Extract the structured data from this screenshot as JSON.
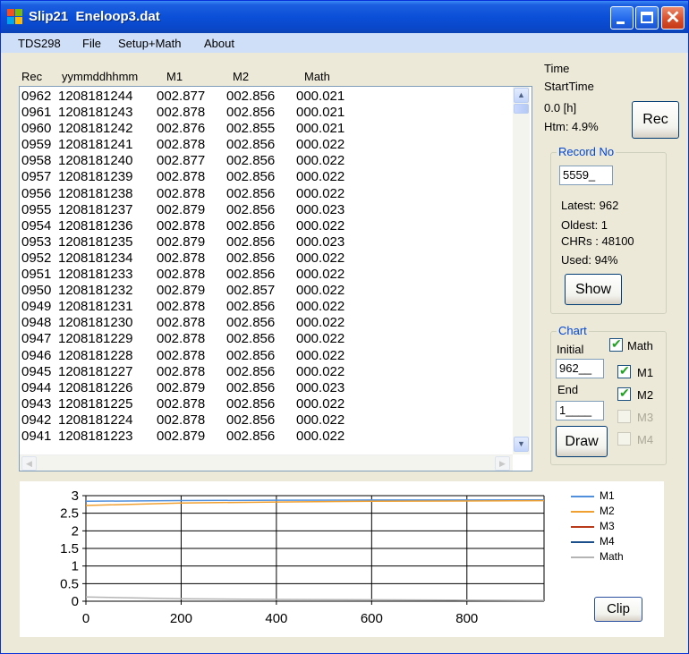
{
  "window": {
    "title": "Slip21  Eneloop3.dat",
    "controls": {
      "minimize": "minimize-icon",
      "maximize": "maximize-icon",
      "close": "close-icon"
    }
  },
  "menu": [
    "TDS298",
    "File",
    "Setup+Math",
    "About"
  ],
  "table": {
    "headers": [
      "Rec",
      "yymmddhhmm",
      "M1",
      "M2",
      "Math"
    ],
    "rows": [
      [
        "0962",
        "1208181244",
        "002.877",
        "002.856",
        "000.021"
      ],
      [
        "0961",
        "1208181243",
        "002.878",
        "002.856",
        "000.021"
      ],
      [
        "0960",
        "1208181242",
        "002.876",
        "002.855",
        "000.021"
      ],
      [
        "0959",
        "1208181241",
        "002.878",
        "002.856",
        "000.022"
      ],
      [
        "0958",
        "1208181240",
        "002.877",
        "002.856",
        "000.022"
      ],
      [
        "0957",
        "1208181239",
        "002.878",
        "002.856",
        "000.022"
      ],
      [
        "0956",
        "1208181238",
        "002.878",
        "002.856",
        "000.022"
      ],
      [
        "0955",
        "1208181237",
        "002.879",
        "002.856",
        "000.023"
      ],
      [
        "0954",
        "1208181236",
        "002.878",
        "002.856",
        "000.022"
      ],
      [
        "0953",
        "1208181235",
        "002.879",
        "002.856",
        "000.023"
      ],
      [
        "0952",
        "1208181234",
        "002.878",
        "002.856",
        "000.022"
      ],
      [
        "0951",
        "1208181233",
        "002.878",
        "002.856",
        "000.022"
      ],
      [
        "0950",
        "1208181232",
        "002.879",
        "002.857",
        "000.022"
      ],
      [
        "0949",
        "1208181231",
        "002.878",
        "002.856",
        "000.022"
      ],
      [
        "0948",
        "1208181230",
        "002.878",
        "002.856",
        "000.022"
      ],
      [
        "0947",
        "1208181229",
        "002.878",
        "002.856",
        "000.022"
      ],
      [
        "0946",
        "1208181228",
        "002.878",
        "002.856",
        "000.022"
      ],
      [
        "0945",
        "1208181227",
        "002.878",
        "002.856",
        "000.022"
      ],
      [
        "0944",
        "1208181226",
        "002.879",
        "002.856",
        "000.023"
      ],
      [
        "0943",
        "1208181225",
        "002.878",
        "002.856",
        "000.022"
      ],
      [
        "0942",
        "1208181224",
        "002.878",
        "002.856",
        "000.022"
      ],
      [
        "0941",
        "1208181223",
        "002.879",
        "002.856",
        "000.022"
      ]
    ]
  },
  "status": {
    "time_label": "Time",
    "start_time_label": "StartTime",
    "elapsed": "0.0 [h]",
    "htm": "Htm: 4.9%"
  },
  "rec_button": "Rec",
  "record_group": {
    "title": "Record No",
    "value": "5559_",
    "latest": "Latest: 962",
    "oldest": "Oldest: 1",
    "chrs": "CHRs : 48100",
    "used": "Used: 94%",
    "show_button": "Show"
  },
  "chart_group": {
    "title": "Chart",
    "initial_label": "Initial",
    "initial_value": "962__",
    "end_label": "End",
    "end_value": "1____",
    "draw_button": "Draw",
    "checks": [
      {
        "label": "Math",
        "checked": true,
        "enabled": true
      },
      {
        "label": "M1",
        "checked": true,
        "enabled": true
      },
      {
        "label": "M2",
        "checked": true,
        "enabled": true
      },
      {
        "label": "M3",
        "checked": false,
        "enabled": false
      },
      {
        "label": "M4",
        "checked": false,
        "enabled": false
      }
    ]
  },
  "clip_button": "Clip",
  "chart_data": {
    "type": "line",
    "xlim": [
      0,
      962
    ],
    "ylim": [
      0,
      3
    ],
    "x_ticks": [
      0,
      200,
      400,
      600,
      800
    ],
    "y_ticks": [
      0,
      0.5,
      1,
      1.5,
      2,
      2.5,
      3
    ],
    "grid": true,
    "legend_position": "right",
    "series": [
      {
        "name": "M1",
        "color": "#4f8fdc",
        "x": [
          0,
          200,
          400,
          600,
          962
        ],
        "y": [
          2.84,
          2.86,
          2.87,
          2.875,
          2.878
        ]
      },
      {
        "name": "M2",
        "color": "#f0a030",
        "x": [
          0,
          200,
          400,
          600,
          962
        ],
        "y": [
          2.72,
          2.79,
          2.82,
          2.84,
          2.856
        ]
      },
      {
        "name": "M3",
        "color": "#b83a1a",
        "x": [],
        "y": []
      },
      {
        "name": "M4",
        "color": "#1a4f8c",
        "x": [],
        "y": []
      },
      {
        "name": "Math",
        "color": "#b4b4b4",
        "x": [
          0,
          200,
          400,
          600,
          800,
          962
        ],
        "y": [
          0.12,
          0.07,
          0.05,
          0.04,
          0.03,
          0.022
        ]
      }
    ]
  }
}
